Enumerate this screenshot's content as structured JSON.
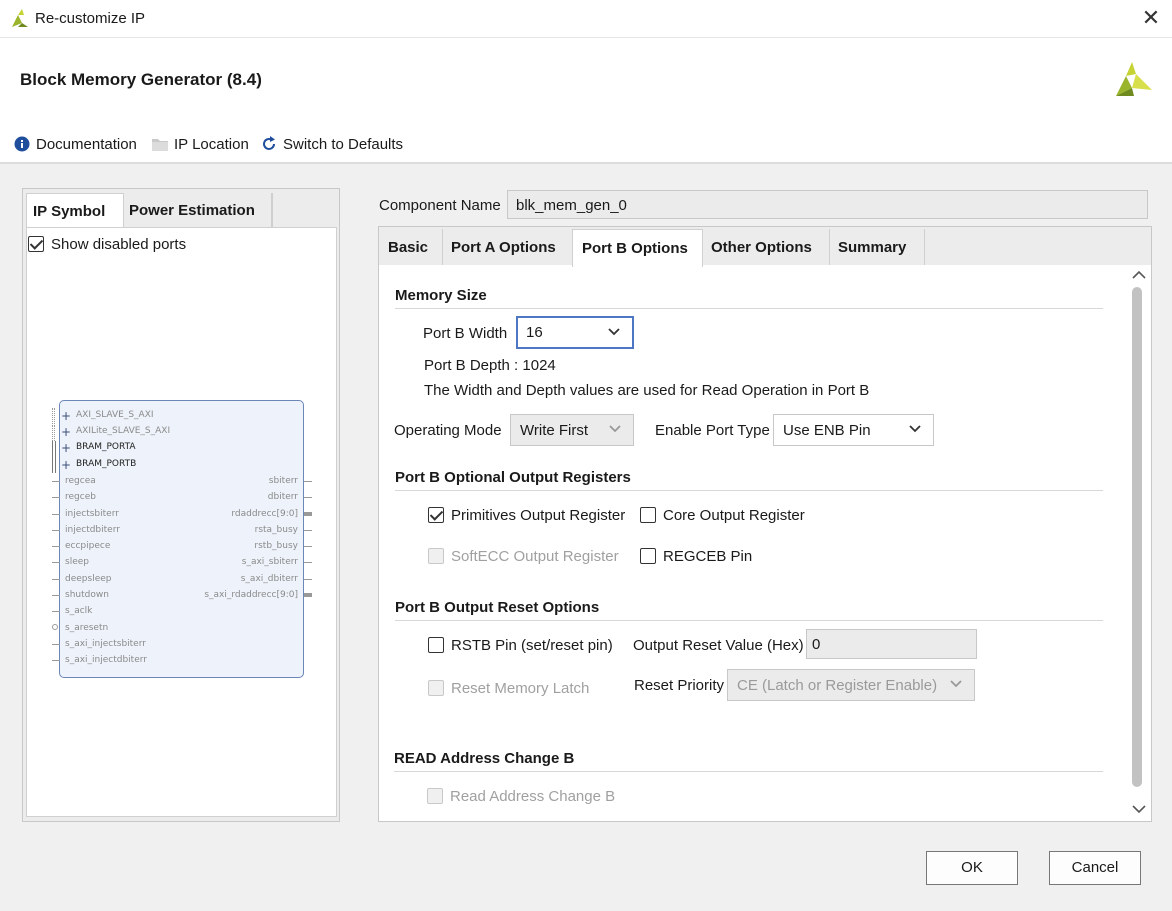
{
  "window": {
    "title": "Re-customize IP",
    "close_glyph": "✕"
  },
  "dialog_title": "Block Memory Generator (8.4)",
  "toolbar": {
    "documentation": "Documentation",
    "ip_location": "IP Location",
    "switch_defaults": "Switch to Defaults"
  },
  "left_tabs": [
    "IP Symbol",
    "Power Estimation"
  ],
  "show_disabled_ports": {
    "label": "Show disabled ports",
    "checked": true
  },
  "symbol": {
    "buses": [
      "AXI_SLAVE_S_AXI",
      "AXILite_SLAVE_S_AXI",
      "BRAM_PORTA",
      "BRAM_PORTB"
    ],
    "left_ports": [
      "regcea",
      "regceb",
      "injectsbiterr",
      "injectdbiterr",
      "eccpipece",
      "sleep",
      "deepsleep",
      "shutdown",
      "s_aclk",
      "s_aresetn",
      "s_axi_injectsbiterr",
      "s_axi_injectdbiterr"
    ],
    "right_ports": [
      "sbiterr",
      "dbiterr",
      "rdaddrecc[9:0]",
      "rsta_busy",
      "rstb_busy",
      "s_axi_sbiterr",
      "s_axi_dbiterr",
      "s_axi_rdaddrecc[9:0]"
    ]
  },
  "component": {
    "label": "Component Name",
    "value": "blk_mem_gen_0"
  },
  "tabs": [
    "Basic",
    "Port A Options",
    "Port B Options",
    "Other Options",
    "Summary"
  ],
  "memory_size": {
    "title": "Memory Size",
    "width_label": "Port B Width",
    "width_value": "16",
    "depth_text": "Port B Depth : 1024",
    "note": "The Width and Depth values are used for Read Operation in Port B"
  },
  "operating_mode": {
    "label": "Operating Mode",
    "value": "Write First"
  },
  "enable_port_type": {
    "label": "Enable Port Type",
    "value": "Use ENB Pin"
  },
  "optional_regs": {
    "title": "Port B Optional Output Registers",
    "primitives": {
      "label": "Primitives Output Register",
      "checked": true
    },
    "core": {
      "label": "Core Output Register",
      "checked": false
    },
    "softecc": {
      "label": "SoftECC Output Register",
      "checked": false,
      "disabled": true
    },
    "regceb": {
      "label": "REGCEB Pin",
      "checked": false
    }
  },
  "reset_options": {
    "title": "Port B Output Reset Options",
    "rstb_pin": {
      "label": "RSTB Pin (set/reset pin)",
      "checked": false
    },
    "reset_value_label": "Output Reset Value (Hex)",
    "reset_value": "0",
    "reset_memory_latch": {
      "label": "Reset Memory Latch",
      "checked": false,
      "disabled": true
    },
    "priority_label": "Reset Priority",
    "priority_value": "CE (Latch or Register Enable)"
  },
  "read_address_change": {
    "title": "READ Address Change B",
    "checkbox": {
      "label": "Read Address Change B",
      "checked": false,
      "disabled": true
    }
  },
  "buttons": {
    "ok": "OK",
    "cancel": "Cancel"
  },
  "colors": {
    "accent_focus": "#4d77c2",
    "brand_yellow": "#c6d334",
    "info_blue": "#1f4e9c"
  }
}
